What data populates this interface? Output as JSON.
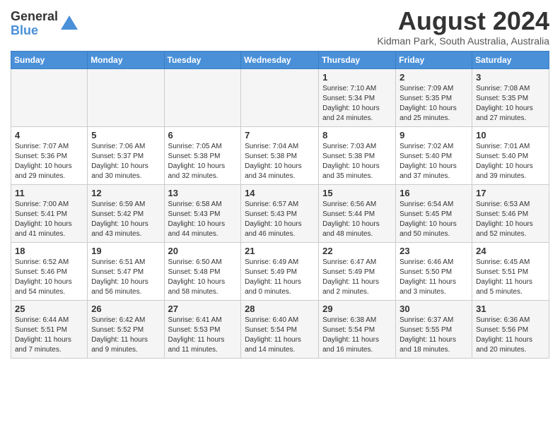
{
  "header": {
    "logo_line1": "General",
    "logo_line2": "Blue",
    "month_year": "August 2024",
    "location": "Kidman Park, South Australia, Australia"
  },
  "weekdays": [
    "Sunday",
    "Monday",
    "Tuesday",
    "Wednesday",
    "Thursday",
    "Friday",
    "Saturday"
  ],
  "weeks": [
    [
      {
        "day": "",
        "info": ""
      },
      {
        "day": "",
        "info": ""
      },
      {
        "day": "",
        "info": ""
      },
      {
        "day": "",
        "info": ""
      },
      {
        "day": "1",
        "info": "Sunrise: 7:10 AM\nSunset: 5:34 PM\nDaylight: 10 hours\nand 24 minutes."
      },
      {
        "day": "2",
        "info": "Sunrise: 7:09 AM\nSunset: 5:35 PM\nDaylight: 10 hours\nand 25 minutes."
      },
      {
        "day": "3",
        "info": "Sunrise: 7:08 AM\nSunset: 5:35 PM\nDaylight: 10 hours\nand 27 minutes."
      }
    ],
    [
      {
        "day": "4",
        "info": "Sunrise: 7:07 AM\nSunset: 5:36 PM\nDaylight: 10 hours\nand 29 minutes."
      },
      {
        "day": "5",
        "info": "Sunrise: 7:06 AM\nSunset: 5:37 PM\nDaylight: 10 hours\nand 30 minutes."
      },
      {
        "day": "6",
        "info": "Sunrise: 7:05 AM\nSunset: 5:38 PM\nDaylight: 10 hours\nand 32 minutes."
      },
      {
        "day": "7",
        "info": "Sunrise: 7:04 AM\nSunset: 5:38 PM\nDaylight: 10 hours\nand 34 minutes."
      },
      {
        "day": "8",
        "info": "Sunrise: 7:03 AM\nSunset: 5:38 PM\nDaylight: 10 hours\nand 35 minutes."
      },
      {
        "day": "9",
        "info": "Sunrise: 7:02 AM\nSunset: 5:40 PM\nDaylight: 10 hours\nand 37 minutes."
      },
      {
        "day": "10",
        "info": "Sunrise: 7:01 AM\nSunset: 5:40 PM\nDaylight: 10 hours\nand 39 minutes."
      }
    ],
    [
      {
        "day": "11",
        "info": "Sunrise: 7:00 AM\nSunset: 5:41 PM\nDaylight: 10 hours\nand 41 minutes."
      },
      {
        "day": "12",
        "info": "Sunrise: 6:59 AM\nSunset: 5:42 PM\nDaylight: 10 hours\nand 43 minutes."
      },
      {
        "day": "13",
        "info": "Sunrise: 6:58 AM\nSunset: 5:43 PM\nDaylight: 10 hours\nand 44 minutes."
      },
      {
        "day": "14",
        "info": "Sunrise: 6:57 AM\nSunset: 5:43 PM\nDaylight: 10 hours\nand 46 minutes."
      },
      {
        "day": "15",
        "info": "Sunrise: 6:56 AM\nSunset: 5:44 PM\nDaylight: 10 hours\nand 48 minutes."
      },
      {
        "day": "16",
        "info": "Sunrise: 6:54 AM\nSunset: 5:45 PM\nDaylight: 10 hours\nand 50 minutes."
      },
      {
        "day": "17",
        "info": "Sunrise: 6:53 AM\nSunset: 5:46 PM\nDaylight: 10 hours\nand 52 minutes."
      }
    ],
    [
      {
        "day": "18",
        "info": "Sunrise: 6:52 AM\nSunset: 5:46 PM\nDaylight: 10 hours\nand 54 minutes."
      },
      {
        "day": "19",
        "info": "Sunrise: 6:51 AM\nSunset: 5:47 PM\nDaylight: 10 hours\nand 56 minutes."
      },
      {
        "day": "20",
        "info": "Sunrise: 6:50 AM\nSunset: 5:48 PM\nDaylight: 10 hours\nand 58 minutes."
      },
      {
        "day": "21",
        "info": "Sunrise: 6:49 AM\nSunset: 5:49 PM\nDaylight: 11 hours\nand 0 minutes."
      },
      {
        "day": "22",
        "info": "Sunrise: 6:47 AM\nSunset: 5:49 PM\nDaylight: 11 hours\nand 2 minutes."
      },
      {
        "day": "23",
        "info": "Sunrise: 6:46 AM\nSunset: 5:50 PM\nDaylight: 11 hours\nand 3 minutes."
      },
      {
        "day": "24",
        "info": "Sunrise: 6:45 AM\nSunset: 5:51 PM\nDaylight: 11 hours\nand 5 minutes."
      }
    ],
    [
      {
        "day": "25",
        "info": "Sunrise: 6:44 AM\nSunset: 5:51 PM\nDaylight: 11 hours\nand 7 minutes."
      },
      {
        "day": "26",
        "info": "Sunrise: 6:42 AM\nSunset: 5:52 PM\nDaylight: 11 hours\nand 9 minutes."
      },
      {
        "day": "27",
        "info": "Sunrise: 6:41 AM\nSunset: 5:53 PM\nDaylight: 11 hours\nand 11 minutes."
      },
      {
        "day": "28",
        "info": "Sunrise: 6:40 AM\nSunset: 5:54 PM\nDaylight: 11 hours\nand 14 minutes."
      },
      {
        "day": "29",
        "info": "Sunrise: 6:38 AM\nSunset: 5:54 PM\nDaylight: 11 hours\nand 16 minutes."
      },
      {
        "day": "30",
        "info": "Sunrise: 6:37 AM\nSunset: 5:55 PM\nDaylight: 11 hours\nand 18 minutes."
      },
      {
        "day": "31",
        "info": "Sunrise: 6:36 AM\nSunset: 5:56 PM\nDaylight: 11 hours\nand 20 minutes."
      }
    ]
  ]
}
